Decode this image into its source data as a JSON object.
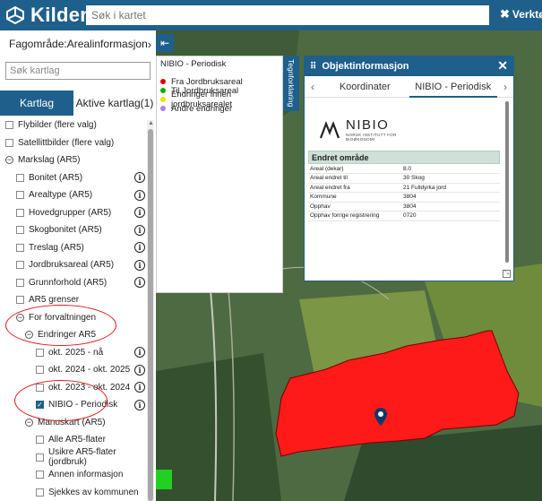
{
  "header": {
    "app_name": "Kilden",
    "search_placeholder": "Søk i kartet",
    "tools_label": "Verktøy"
  },
  "left_panel": {
    "fagomrade_label": "Fagområde:",
    "fagomrade_value": "Arealinformasjon",
    "search_placeholder": "Søk kartlag",
    "tabs": [
      {
        "label": "Kartlag",
        "active": true
      },
      {
        "label": "Aktive kartlag(1)",
        "active": false
      }
    ],
    "tree": [
      {
        "label": "Flybilder (flere valg)",
        "level": 0,
        "kind": "checkbox",
        "checked": false,
        "info": false
      },
      {
        "label": "Satellittbilder (flere valg)",
        "level": 0,
        "kind": "checkbox",
        "checked": false,
        "info": false
      },
      {
        "label": "Markslag (AR5)",
        "level": 0,
        "kind": "group",
        "info": false
      },
      {
        "label": "Bonitet (AR5)",
        "level": 1,
        "kind": "checkbox",
        "checked": false,
        "info": true
      },
      {
        "label": "Arealtype (AR5)",
        "level": 1,
        "kind": "checkbox",
        "checked": false,
        "info": true
      },
      {
        "label": "Hovedgrupper (AR5)",
        "level": 1,
        "kind": "checkbox",
        "checked": false,
        "info": true
      },
      {
        "label": "Skogbonitet (AR5)",
        "level": 1,
        "kind": "checkbox",
        "checked": false,
        "info": true
      },
      {
        "label": "Treslag (AR5)",
        "level": 1,
        "kind": "checkbox",
        "checked": false,
        "info": true
      },
      {
        "label": "Jordbruksareal (AR5)",
        "level": 1,
        "kind": "checkbox",
        "checked": false,
        "info": true
      },
      {
        "label": "Grunnforhold (AR5)",
        "level": 1,
        "kind": "checkbox",
        "checked": false,
        "info": true
      },
      {
        "label": "AR5 grenser",
        "level": 1,
        "kind": "checkbox",
        "checked": false,
        "info": false
      },
      {
        "label": "For forvaltningen",
        "level": 1,
        "kind": "group",
        "info": false
      },
      {
        "label": "Endringer AR5",
        "level": 2,
        "kind": "group",
        "info": false
      },
      {
        "label": "okt. 2025 - nå",
        "level": 3,
        "kind": "checkbox",
        "checked": false,
        "info": true
      },
      {
        "label": "okt. 2024 - okt. 2025",
        "level": 3,
        "kind": "checkbox",
        "checked": false,
        "info": true
      },
      {
        "label": "okt. 2023 - okt. 2024",
        "level": 3,
        "kind": "checkbox",
        "checked": false,
        "info": true
      },
      {
        "label": "NIBIO - Periodisk",
        "level": 3,
        "kind": "checkbox",
        "checked": true,
        "info": true
      },
      {
        "label": "Manuskart (AR5)",
        "level": 2,
        "kind": "group",
        "info": false
      },
      {
        "label": "Alle AR5-flater",
        "level": 3,
        "kind": "checkbox",
        "checked": false,
        "info": false
      },
      {
        "label": "Usikre AR5-flater (jordbruk)",
        "level": 3,
        "kind": "checkbox",
        "checked": false,
        "info": false
      },
      {
        "label": "Annen informasjon",
        "level": 3,
        "kind": "checkbox",
        "checked": false,
        "info": false
      },
      {
        "label": "Sjekkes av kommunen",
        "level": 3,
        "kind": "checkbox",
        "checked": false,
        "info": false
      }
    ]
  },
  "legend": {
    "title": "NIBIO - Periodisk",
    "items": [
      {
        "label": "Fra Jordbruksareal",
        "color": "#e00000"
      },
      {
        "label": "Til Jordbruksareal",
        "color": "#00b000"
      },
      {
        "label": "Endringer innen jordbruksarealet",
        "color": "#f0e000"
      },
      {
        "label": "Andre endringer",
        "color": "#b080e0"
      }
    ],
    "tab_label": "Tegnforklaring"
  },
  "popup": {
    "title": "Objektinformasjon",
    "tabs": [
      {
        "label": "Koordinater",
        "selected": false
      },
      {
        "label": "NIBIO - Periodisk",
        "selected": true
      }
    ],
    "logo_name": "NIBIO",
    "logo_sub1": "NORSK INSTITUTT FOR",
    "logo_sub2": "BIOØKONOMI",
    "section_title": "Endret område",
    "rows": [
      {
        "key": "Areal (dekar)",
        "value": "8.0"
      },
      {
        "key": "Areal endret til",
        "value": "30 Skog"
      },
      {
        "key": "Areal endret fra",
        "value": "21 Fulldyrka jord"
      },
      {
        "key": "Kommune",
        "value": "3804"
      },
      {
        "key": "Opphav",
        "value": "3804"
      },
      {
        "key": "Opphav forrige registrering",
        "value": "0720"
      }
    ]
  },
  "colors": {
    "brand": "#1f5f8b",
    "polygon_fill": "#ff1a1a",
    "highlight": "#e01818"
  }
}
